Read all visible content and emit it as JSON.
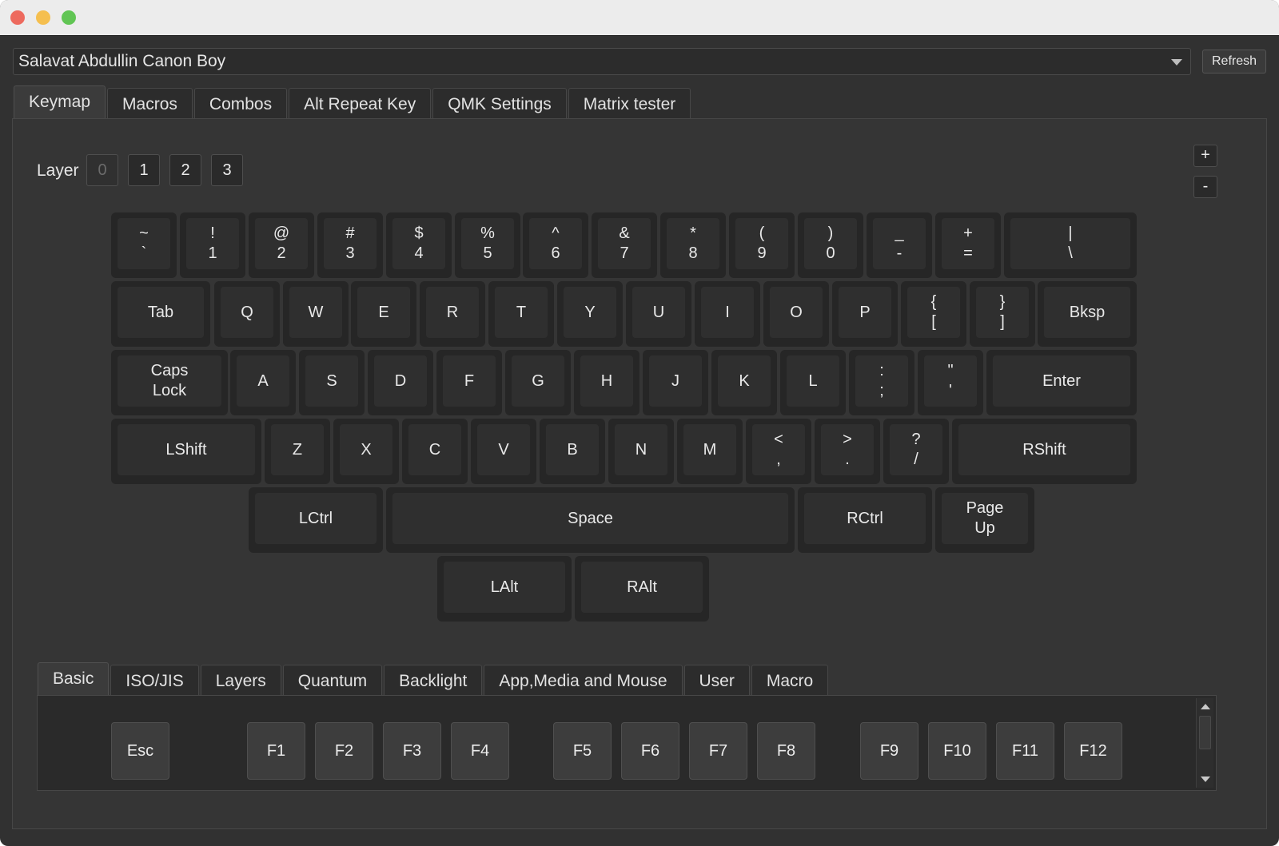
{
  "window": {
    "device_name": "Salavat Abdullin Canon Boy",
    "refresh_label": "Refresh",
    "traffic_light_colors": {
      "close": "#ed6a5e",
      "minimize": "#f5bf4f",
      "zoom": "#61c554"
    }
  },
  "main_tabs": [
    {
      "label": "Keymap",
      "active": true
    },
    {
      "label": "Macros",
      "active": false
    },
    {
      "label": "Combos",
      "active": false
    },
    {
      "label": "Alt Repeat Key",
      "active": false
    },
    {
      "label": "QMK Settings",
      "active": false
    },
    {
      "label": "Matrix tester",
      "active": false
    }
  ],
  "layers": {
    "label": "Layer",
    "buttons": [
      "0",
      "1",
      "2",
      "3"
    ],
    "active": "0"
  },
  "zoom_controls": {
    "plus": "+",
    "minus": "-"
  },
  "keys": [
    {
      "id": "grave",
      "labels": [
        "~",
        "`"
      ]
    },
    {
      "id": "1",
      "labels": [
        "!",
        "1"
      ]
    },
    {
      "id": "2",
      "labels": [
        "@",
        "2"
      ]
    },
    {
      "id": "3",
      "labels": [
        "#",
        "3"
      ]
    },
    {
      "id": "4",
      "labels": [
        "$",
        "4"
      ]
    },
    {
      "id": "5",
      "labels": [
        "%",
        "5"
      ]
    },
    {
      "id": "6",
      "labels": [
        "^",
        "6"
      ]
    },
    {
      "id": "7",
      "labels": [
        "&",
        "7"
      ]
    },
    {
      "id": "8",
      "labels": [
        "*",
        "8"
      ]
    },
    {
      "id": "9",
      "labels": [
        "(",
        "9"
      ]
    },
    {
      "id": "0",
      "labels": [
        ")",
        "0"
      ]
    },
    {
      "id": "minus",
      "labels": [
        "_",
        "-"
      ]
    },
    {
      "id": "equal",
      "labels": [
        "+",
        "="
      ]
    },
    {
      "id": "backslash",
      "labels": [
        "|",
        "\\"
      ]
    },
    {
      "id": "tab",
      "labels": [
        "Tab"
      ]
    },
    {
      "id": "q",
      "labels": [
        "Q"
      ]
    },
    {
      "id": "w",
      "labels": [
        "W"
      ]
    },
    {
      "id": "e",
      "labels": [
        "E"
      ]
    },
    {
      "id": "r",
      "labels": [
        "R"
      ]
    },
    {
      "id": "t",
      "labels": [
        "T"
      ]
    },
    {
      "id": "y",
      "labels": [
        "Y"
      ]
    },
    {
      "id": "u",
      "labels": [
        "U"
      ]
    },
    {
      "id": "i",
      "labels": [
        "I"
      ]
    },
    {
      "id": "o",
      "labels": [
        "O"
      ]
    },
    {
      "id": "p",
      "labels": [
        "P"
      ]
    },
    {
      "id": "lbracket",
      "labels": [
        "{",
        "["
      ]
    },
    {
      "id": "rbracket",
      "labels": [
        "}",
        "]"
      ]
    },
    {
      "id": "bksp",
      "labels": [
        "Bksp"
      ]
    },
    {
      "id": "caps",
      "labels": [
        "Caps",
        "Lock"
      ]
    },
    {
      "id": "a",
      "labels": [
        "A"
      ]
    },
    {
      "id": "s",
      "labels": [
        "S"
      ]
    },
    {
      "id": "d",
      "labels": [
        "D"
      ]
    },
    {
      "id": "f",
      "labels": [
        "F"
      ]
    },
    {
      "id": "g",
      "labels": [
        "G"
      ]
    },
    {
      "id": "h",
      "labels": [
        "H"
      ]
    },
    {
      "id": "j",
      "labels": [
        "J"
      ]
    },
    {
      "id": "k",
      "labels": [
        "K"
      ]
    },
    {
      "id": "l",
      "labels": [
        "L"
      ]
    },
    {
      "id": "semicolon",
      "labels": [
        ":",
        ";"
      ]
    },
    {
      "id": "quote",
      "labels": [
        "\"",
        "'"
      ]
    },
    {
      "id": "enter",
      "labels": [
        "Enter"
      ]
    },
    {
      "id": "lshift",
      "labels": [
        "LShift"
      ]
    },
    {
      "id": "z",
      "labels": [
        "Z"
      ]
    },
    {
      "id": "x",
      "labels": [
        "X"
      ]
    },
    {
      "id": "c",
      "labels": [
        "C"
      ]
    },
    {
      "id": "v",
      "labels": [
        "V"
      ]
    },
    {
      "id": "b",
      "labels": [
        "B"
      ]
    },
    {
      "id": "n",
      "labels": [
        "N"
      ]
    },
    {
      "id": "m",
      "labels": [
        "M"
      ]
    },
    {
      "id": "comma",
      "labels": [
        "<",
        ","
      ]
    },
    {
      "id": "period",
      "labels": [
        ">",
        "."
      ]
    },
    {
      "id": "slash",
      "labels": [
        "?",
        "/"
      ]
    },
    {
      "id": "rshift",
      "labels": [
        "RShift"
      ]
    },
    {
      "id": "lctrl",
      "labels": [
        "LCtrl"
      ]
    },
    {
      "id": "space",
      "labels": [
        "Space"
      ]
    },
    {
      "id": "rctrl",
      "labels": [
        "RCtrl"
      ]
    },
    {
      "id": "pgup",
      "labels": [
        "Page",
        "Up"
      ]
    },
    {
      "id": "lalt",
      "labels": [
        "LAlt"
      ]
    },
    {
      "id": "ralt",
      "labels": [
        "RAlt"
      ]
    }
  ],
  "keycode_tabs": [
    {
      "label": "Basic",
      "active": true
    },
    {
      "label": "ISO/JIS",
      "active": false
    },
    {
      "label": "Layers",
      "active": false
    },
    {
      "label": "Quantum",
      "active": false
    },
    {
      "label": "Backlight",
      "active": false
    },
    {
      "label": "App,Media and Mouse",
      "active": false
    },
    {
      "label": "User",
      "active": false
    },
    {
      "label": "Macro",
      "active": false
    }
  ],
  "keycodes": [
    "Esc",
    "F1",
    "F2",
    "F3",
    "F4",
    "F5",
    "F6",
    "F7",
    "F8",
    "F9",
    "F10",
    "F11",
    "F12"
  ]
}
